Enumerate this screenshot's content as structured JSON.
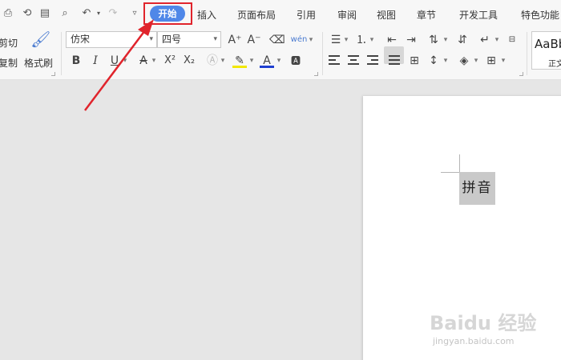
{
  "menu": {
    "tabs": [
      "插入",
      "页面布局",
      "引用",
      "审阅",
      "视图",
      "章节",
      "开发工具",
      "特色功能"
    ],
    "active_tab": "开始"
  },
  "clipboard": {
    "cut": "剪切",
    "copy": "复制",
    "format_painter": "格式刷"
  },
  "font": {
    "name": "仿宋",
    "size": "四号"
  },
  "ribbon_glyphs": {
    "bold": "B",
    "italic": "I",
    "underline": "U",
    "strike": "A",
    "superscript": "X²",
    "subscript": "X₂",
    "font_color": "A",
    "grow": "A⁺",
    "shrink": "A⁻",
    "pinyin": "wén"
  },
  "styles": {
    "preview": "AaBb",
    "name": "正文"
  },
  "document": {
    "selected_text": "拼音"
  },
  "watermark": {
    "logo": "Baidu 经验",
    "url": "jingyan.baidu.com"
  },
  "colors": {
    "accent": "#4f87e8",
    "highlight_border": "#e0242c",
    "arrow": "#e0242c"
  }
}
